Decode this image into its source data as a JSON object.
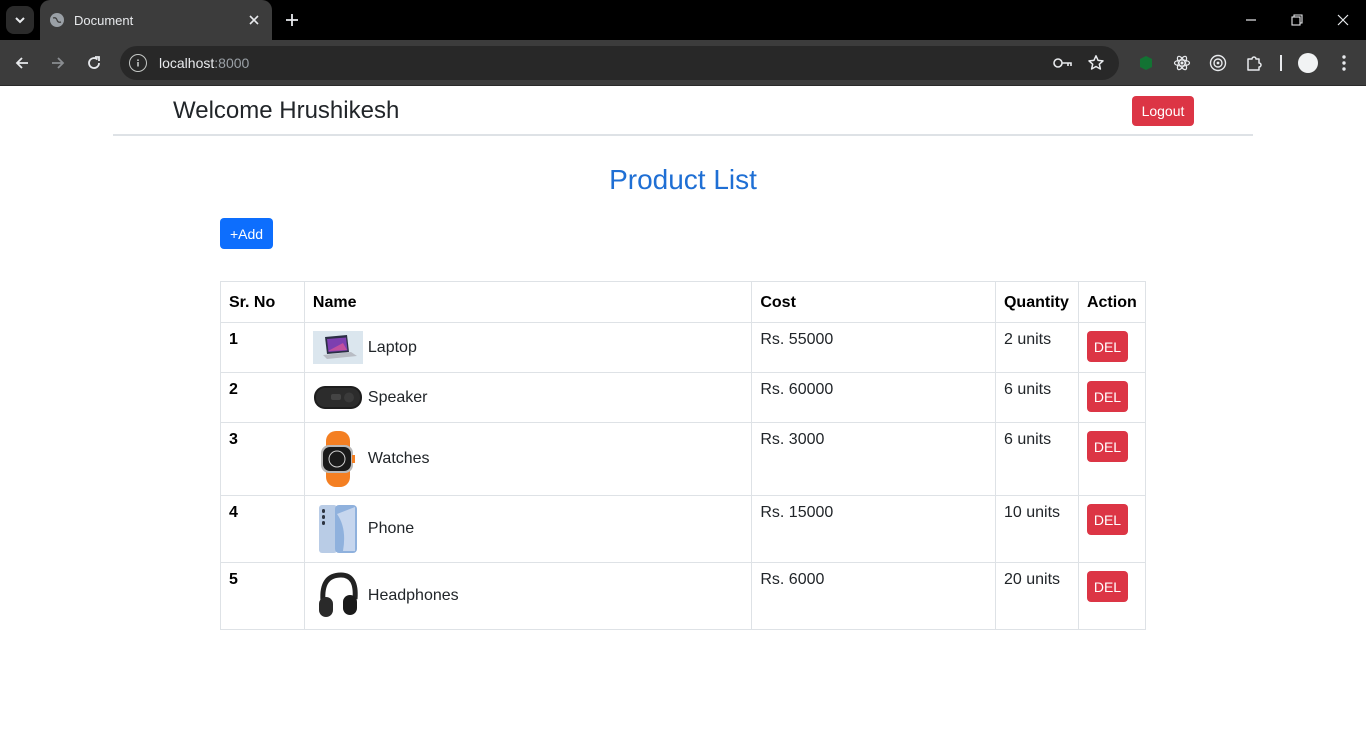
{
  "browser": {
    "tab_title": "Document",
    "url_host": "localhost",
    "url_port": ":8000"
  },
  "header": {
    "welcome": "Welcome Hrushikesh",
    "logout_label": "Logout"
  },
  "main": {
    "title": "Product List",
    "add_label": "+Add",
    "del_label": "DEL",
    "columns": [
      "Sr. No",
      "Name",
      "Cost",
      "Quantity",
      "Action"
    ],
    "rows": [
      {
        "sr": "1",
        "name": "Laptop",
        "cost": "Rs. 55000",
        "qty": "2 units"
      },
      {
        "sr": "2",
        "name": "Speaker",
        "cost": "Rs. 60000",
        "qty": "6 units"
      },
      {
        "sr": "3",
        "name": "Watches",
        "cost": "Rs. 3000",
        "qty": "6 units"
      },
      {
        "sr": "4",
        "name": "Phone",
        "cost": "Rs. 15000",
        "qty": "10 units"
      },
      {
        "sr": "5",
        "name": "Headphones",
        "cost": "Rs. 6000",
        "qty": "20 units"
      }
    ]
  },
  "colors": {
    "danger": "#dc3545",
    "primary": "#0d6efd",
    "title": "#1f6fd4"
  },
  "icons": [
    "tab-list-icon",
    "globe-icon",
    "close-icon",
    "plus-icon",
    "minimize-icon",
    "restore-icon",
    "back-icon",
    "forward-icon",
    "reload-icon",
    "site-info-icon",
    "password-key-icon",
    "star-icon",
    "extension-green-icon",
    "react-icon",
    "target-icon",
    "puzzle-icon",
    "profile-icon",
    "menu-dots-icon"
  ]
}
